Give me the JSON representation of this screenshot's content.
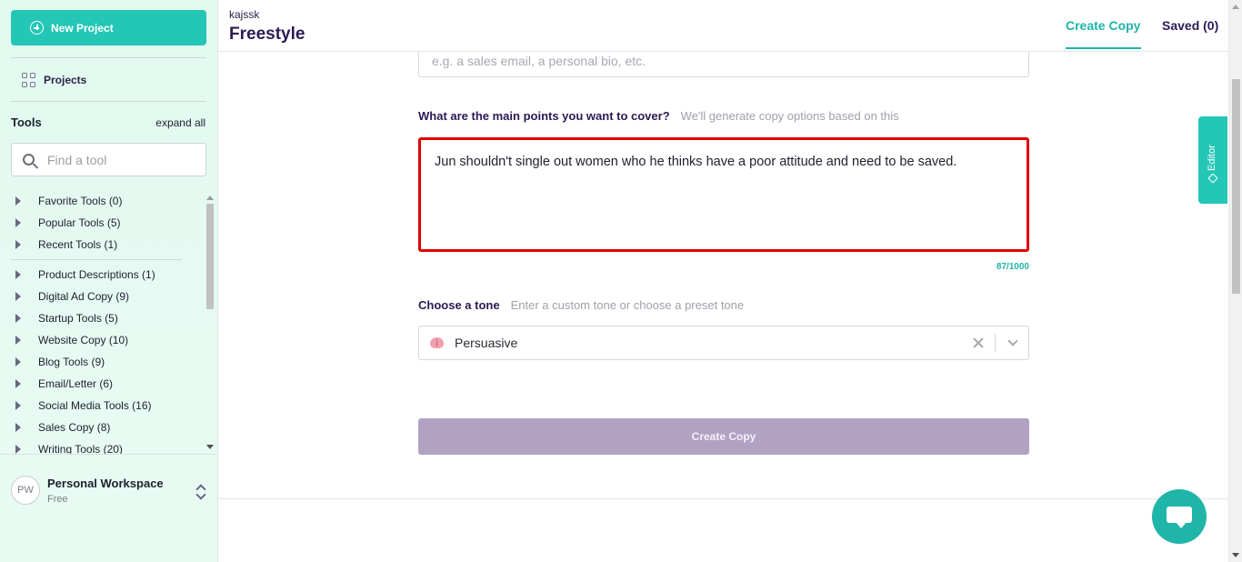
{
  "sidebar": {
    "new_project_label": "New Project",
    "projects_label": "Projects",
    "tools_title": "Tools",
    "expand_all": "expand all",
    "search_placeholder": "Find a tool",
    "pinned_tools": [
      {
        "label": "Favorite Tools (0)"
      },
      {
        "label": "Popular Tools (5)"
      },
      {
        "label": "Recent Tools (1)"
      }
    ],
    "tool_categories": [
      {
        "label": "Product Descriptions (1)"
      },
      {
        "label": "Digital Ad Copy (9)"
      },
      {
        "label": "Startup Tools (5)"
      },
      {
        "label": "Website Copy (10)"
      },
      {
        "label": "Blog Tools (9)"
      },
      {
        "label": "Email/Letter (6)"
      },
      {
        "label": "Social Media Tools (16)"
      },
      {
        "label": "Sales Copy (8)"
      },
      {
        "label": "Writing Tools (20)"
      }
    ],
    "workspace": {
      "initials": "PW",
      "name": "Personal Workspace",
      "plan": "Free"
    }
  },
  "header": {
    "breadcrumb": "kajssk",
    "title": "Freestyle",
    "tabs": {
      "create": "Create Copy",
      "saved": "Saved (0)"
    }
  },
  "form": {
    "type_placeholder": "e.g. a sales email, a personal bio, etc.",
    "points_label": "What are the main points you want to cover?",
    "points_hint": "We'll generate copy options based on this",
    "points_value": "Jun shouldn't single out women who he thinks have a poor attitude and need to be saved.",
    "char_counter": "87/1000",
    "tone_label": "Choose a tone",
    "tone_hint": "Enter a custom tone or choose a preset tone",
    "tone_value": "Persuasive",
    "tone_icon": "brain-icon",
    "submit_label": "Create Copy"
  },
  "editor_tab": "Editor",
  "colors": {
    "accent": "#24c6b6",
    "brand_dark": "#2b1a55",
    "error_border": "#e00000",
    "button_disabled": "#b1a2c4"
  }
}
